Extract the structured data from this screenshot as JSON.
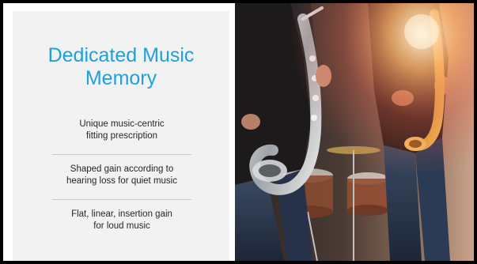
{
  "slide": {
    "title": "Dedicated Music Memory",
    "bullets": [
      {
        "text": "Unique music-centric\nfitting prescription"
      },
      {
        "text": "Shaped gain according to\nhearing loss for quiet music"
      },
      {
        "text": "Flat, linear, insertion gain\nfor loud music"
      }
    ],
    "photo": {
      "subject_icon": "saxophone-players-photo"
    }
  },
  "colors": {
    "title": "#1ba1de",
    "text": "#262626",
    "card_bg": "#f2f2f2",
    "frame": "#000000"
  }
}
